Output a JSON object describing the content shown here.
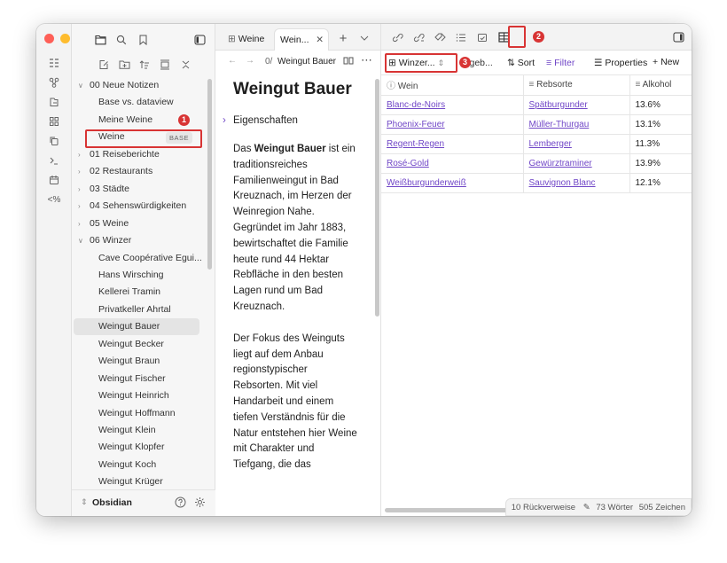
{
  "colors": {
    "traffic_red": "#fe5f57",
    "traffic_yellow": "#febc2e",
    "traffic_green": "#28c840",
    "accent": "#7046c7",
    "annotation_red": "#d83434"
  },
  "ribbon": {
    "icons": [
      "lines-icon",
      "graph-icon",
      "folder-open-icon",
      "grid-icon",
      "copy-icon",
      "terminal-icon",
      "calendar-icon",
      "code-percent-icon"
    ],
    "code_label": "<%"
  },
  "sidebar": {
    "tree": [
      {
        "label": "00 Neue Notizen",
        "level": 0,
        "expanded": true
      },
      {
        "label": "Base vs. dataview",
        "level": 1
      },
      {
        "label": "Meine Weine",
        "level": 1
      },
      {
        "label": "Weine",
        "level": 1,
        "tag": "BASE"
      },
      {
        "label": "01 Reiseberichte",
        "level": 0,
        "expanded": false
      },
      {
        "label": "02 Restaurants",
        "level": 0,
        "expanded": false
      },
      {
        "label": "03 Städte",
        "level": 0,
        "expanded": false
      },
      {
        "label": "04 Sehenswürdigkeiten",
        "level": 0,
        "expanded": false
      },
      {
        "label": "05 Weine",
        "level": 0,
        "expanded": false
      },
      {
        "label": "06 Winzer",
        "level": 0,
        "expanded": true
      },
      {
        "label": "Cave Coopérative Egui...",
        "level": 1
      },
      {
        "label": "Hans Wirsching",
        "level": 1
      },
      {
        "label": "Kellerei Tramin",
        "level": 1
      },
      {
        "label": "Privatkeller Ahrtal",
        "level": 1
      },
      {
        "label": "Weingut Bauer",
        "level": 1,
        "active": true
      },
      {
        "label": "Weingut Becker",
        "level": 1
      },
      {
        "label": "Weingut Braun",
        "level": 1
      },
      {
        "label": "Weingut Fischer",
        "level": 1
      },
      {
        "label": "Weingut Heinrich",
        "level": 1
      },
      {
        "label": "Weingut Hoffmann",
        "level": 1
      },
      {
        "label": "Weingut Klein",
        "level": 1
      },
      {
        "label": "Weingut Klopfer",
        "level": 1
      },
      {
        "label": "Weingut Koch",
        "level": 1
      },
      {
        "label": "Weingut Krüger",
        "level": 1
      }
    ],
    "vault_name": "Obsidian"
  },
  "tabs": [
    {
      "label": "Weine",
      "active": false
    },
    {
      "label": "Wein...",
      "active": true
    }
  ],
  "note": {
    "breadcrumb_prefix": "0/",
    "breadcrumb_title": "Weingut Bauer",
    "title": "Weingut Bauer",
    "properties_label": "Eigenschaften",
    "p1_before": "Das ",
    "p1_bold": "Weingut Bauer",
    "p1_after": " ist ein traditionsreiches Familienweingut in Bad Kreuznach, im Herzen der Weinregion Nahe. Gegründet im Jahr 1883, bewirtschaftet die Familie heute rund 44 Hektar Rebfläche in den besten Lagen rund um Bad Kreuznach.",
    "p2": "Der Fokus des Weinguts liegt auf dem Anbau regionstypischer Rebsorten. Mit viel Handarbeit und einem tiefen Verständnis für die Natur entstehen hier Weine mit Charakter und Tiefgang, die das"
  },
  "base": {
    "view_label": "Winzer...",
    "results_label": "rgeb...",
    "sort_label": "Sort",
    "filter_label": "Filter",
    "properties_label": "Properties",
    "new_label": "New",
    "columns": [
      "Wein",
      "Rebsorte",
      "Alkohol"
    ],
    "rows": [
      [
        "Blanc-de-Noirs",
        "Spätburgunder",
        "13.6%"
      ],
      [
        "Phoenix-Feuer",
        "Müller-Thurgau",
        "13.1%"
      ],
      [
        "Regent-Regen",
        "Lemberger",
        "11.3%"
      ],
      [
        "Rosé-Gold",
        "Gewürztraminer",
        "13.9%"
      ],
      [
        "Weißburgunderweiß",
        "Sauvignon Blanc",
        "12.1%"
      ]
    ]
  },
  "status": {
    "backlinks": "10 Rückverweise",
    "words": "73 Wörter",
    "chars": "505 Zeichen"
  },
  "annotations": [
    "1",
    "2",
    "3"
  ]
}
